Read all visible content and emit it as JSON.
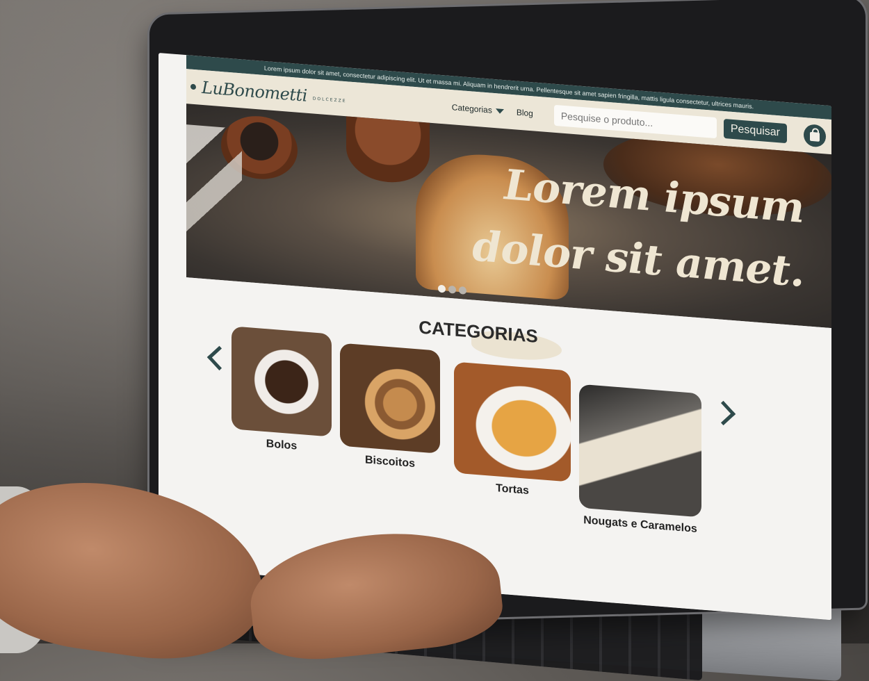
{
  "topbar": {
    "announcement": "Lorem ipsum dolor sit amet, consectetur adipiscing elit. Ut et massa mi. Aliquam in hendrerit urna. Pellentesque sit amet sapien fringilla, mattis ligula consectetur, ultrices mauris."
  },
  "header": {
    "logo_text": "LuBonometti",
    "logo_sub": "DOLCEZZE",
    "nav_categories": "Categorias",
    "nav_blog": "Blog",
    "search_placeholder": "Pesquise o produto...",
    "search_button": "Pesquisar",
    "cart_icon": "shopping-bag-icon"
  },
  "hero": {
    "title": "Lorem ipsum dolor sit amet.",
    "slides": 3,
    "active_slide": 1
  },
  "categories": {
    "title": "CATEGORIAS",
    "items": [
      {
        "label": "Bolos"
      },
      {
        "label": "Biscoitos"
      },
      {
        "label": "Tortas"
      },
      {
        "label": "Nougats e Caramelos"
      }
    ]
  },
  "colors": {
    "brand": "#2e4a4b",
    "header_bg": "#ece6d7",
    "hero_text": "#efe6d2"
  }
}
